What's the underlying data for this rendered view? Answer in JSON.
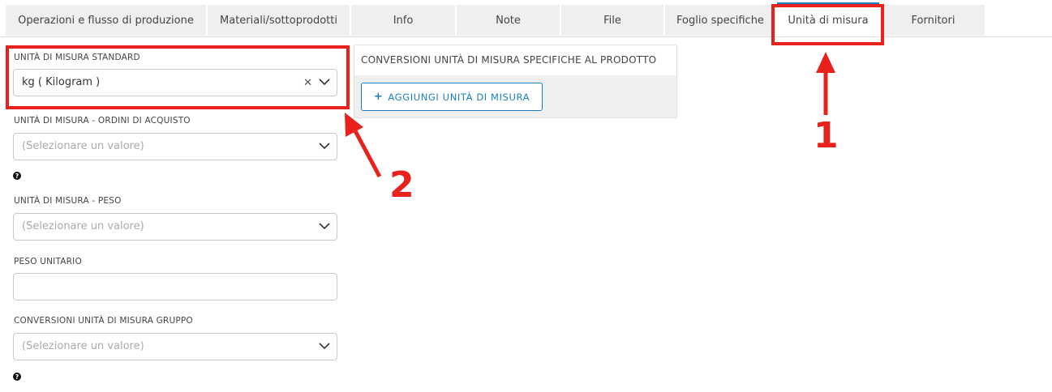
{
  "tabs": [
    {
      "label": "Operazioni e flusso di produzione",
      "active": false
    },
    {
      "label": "Materiali/sottoprodotti",
      "active": false
    },
    {
      "label": "Info",
      "active": false
    },
    {
      "label": "Note",
      "active": false
    },
    {
      "label": "File",
      "active": false
    },
    {
      "label": "Foglio specifiche",
      "active": false
    },
    {
      "label": "Unità di misura",
      "active": true
    },
    {
      "label": "Fornitori",
      "active": false
    }
  ],
  "form": {
    "standard_uom": {
      "label": "UNITÀ DI MISURA STANDARD",
      "value": "kg ( Kilogram )"
    },
    "purchase_uom": {
      "label": "UNITÀ DI MISURA - ORDINI DI ACQUISTO",
      "placeholder": "(Selezionare un valore)"
    },
    "weight_uom": {
      "label": "UNITÀ DI MISURA - PESO",
      "placeholder": "(Selezionare un valore)"
    },
    "unit_weight": {
      "label": "PESO UNITARIO",
      "value": ""
    },
    "group_conversions": {
      "label": "CONVERSIONI UNITÀ DI MISURA GRUPPO",
      "placeholder": "(Selezionare un valore)"
    },
    "help_glyph": "?"
  },
  "conversions_panel": {
    "title": "CONVERSIONI UNITÀ DI MISURA SPECIFICHE AL PRODOTTO",
    "add_button": {
      "icon": "+",
      "label": "AGGIUNGI UNITÀ DI MISURA"
    }
  },
  "annotations": {
    "marker_1": "1",
    "marker_2": "2",
    "color": "#e8211c"
  },
  "colors": {
    "accent": "#1a7fc1",
    "tab_bg": "#efefef"
  }
}
